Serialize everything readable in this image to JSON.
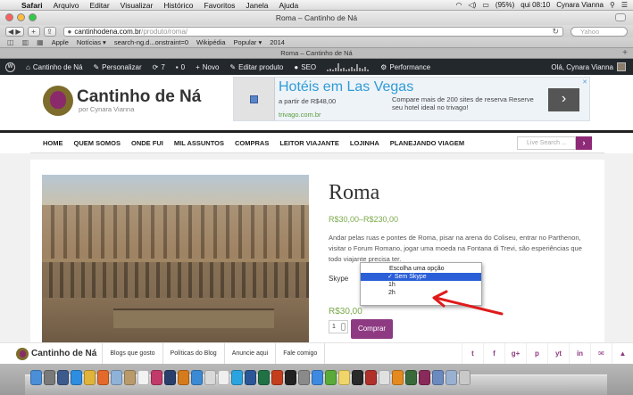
{
  "menubar": {
    "app": "Safari",
    "items": [
      "Arquivo",
      "Editar",
      "Visualizar",
      "Histórico",
      "Favoritos",
      "Janela",
      "Ajuda"
    ],
    "battery": "(95%)",
    "clock": "qui 08:10",
    "user": "Cynara Vianna"
  },
  "window": {
    "title": "Roma – Cantinho de Ná",
    "url_host": "cantinhodena.com.br",
    "url_path": "/produto/roma/",
    "search_placeholder": "Yahoo",
    "tab_title": "Roma – Cantinho de Ná"
  },
  "bookmarks": [
    "Apple",
    "Notícias ▾",
    "search-ng.d...onstraint=0",
    "Wikipédia",
    "Popular ▾",
    "2014"
  ],
  "adminbar": {
    "site": "Cantinho de Ná",
    "customize": "Personalizar",
    "updates": "7",
    "comments": "0",
    "new": "Novo",
    "edit": "Editar produto",
    "seo": "SEO",
    "performance": "Performance",
    "greeting": "Olá, Cynara Vianna"
  },
  "site": {
    "logo_title": "Cantinho de Ná",
    "logo_sub": "por Cynara Vianna"
  },
  "ad": {
    "title": "Hotéis em Las Vegas",
    "price_text": "a partir de R$48,00",
    "body": "Compare mais de 200 sites de reserva Reserve seu hotel ideal no trivago!",
    "link": "trivago.com.br",
    "arrow": "›",
    "close": "✕"
  },
  "nav": {
    "items": [
      "HOME",
      "QUEM SOMOS",
      "ONDE FUI",
      "MIL ASSUNTOS",
      "COMPRAS",
      "LEITOR VIAJANTE",
      "LOJINHA",
      "PLANEJANDO VIAGEM"
    ],
    "search_placeholder": "Live Search ..."
  },
  "product": {
    "title": "Roma",
    "price_range": "R$30,00–R$230,00",
    "description": "Andar pelas ruas e pontes de Roma, pisar na arena do Coliseu, entrar no Parthenon, visitar o Forum Romano, jogar uma moeda na Fontana di Trevi, são esperiências que todo viajante precisa ter.",
    "variation_label": "Skype",
    "options": [
      "Escolha uma opção",
      "Sem Skype",
      "1h",
      "2h"
    ],
    "selected_option": "Sem Skype",
    "selected_price": "R$30,00",
    "quantity": "1",
    "buy_label": "Comprar"
  },
  "footer": {
    "logo": "Cantinho de Ná",
    "links": [
      "Blogs que gosto",
      "Políticas do Blog",
      "Anuncie aqui",
      "Fale comigo"
    ],
    "social": [
      "t",
      "f",
      "g+",
      "p",
      "yt",
      "in",
      "✉"
    ],
    "back_to_top": "▲"
  },
  "colors": {
    "brand_purple": "#8e3a82",
    "price_green": "#7aa94a",
    "ad_title_blue": "#2f9bd6",
    "admin_bar": "#23282d",
    "selection_blue": "#2a5fd8",
    "annotation_red": "#e01a1a"
  }
}
